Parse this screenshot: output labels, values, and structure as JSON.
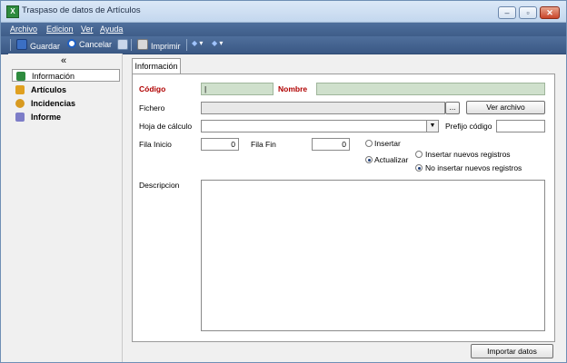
{
  "window": {
    "title": "Traspaso de datos de Artículos"
  },
  "menu": {
    "items": [
      "Archivo",
      "Edicion",
      "Ver",
      "Ayuda"
    ]
  },
  "toolbar": {
    "guardar": "Guardar",
    "cancelar": "Cancelar",
    "imprimir": "Imprimir"
  },
  "sidebar": {
    "collapse": "«",
    "items": [
      {
        "label": "Información",
        "selected": true
      },
      {
        "label": "Artículos",
        "selected": false
      },
      {
        "label": "Incidencias",
        "selected": false
      },
      {
        "label": "Informe",
        "selected": false
      }
    ]
  },
  "tabs": [
    "Información"
  ],
  "form": {
    "codigo_label": "Código",
    "codigo_value": "|",
    "nombre_label": "Nombre",
    "nombre_value": "",
    "fichero_label": "Fichero",
    "fichero_value": "",
    "browse_label": "...",
    "ver_archivo_label": "Ver archivo",
    "hoja_label": "Hoja de cálculo",
    "hoja_value": "",
    "prefijo_label": "Prefijo código",
    "prefijo_value": "",
    "fila_inicio_label": "Fila Inicio",
    "fila_inicio_value": "0",
    "fila_fin_label": "Fila Fin",
    "fila_fin_value": "0",
    "insertar_label": "Insertar",
    "actualizar_label": "Actualizar",
    "insertar_nuevos_label": "Insertar nuevos registros",
    "no_insertar_label": "No insertar nuevos registros",
    "descripcion_label": "Descripcion",
    "descripcion_value": ""
  },
  "footer": {
    "importar_label": "Importar datos"
  },
  "colors": {
    "menubar": "#4f6f9c",
    "required_label": "#b00000",
    "green_field": "#cfe0cc"
  }
}
